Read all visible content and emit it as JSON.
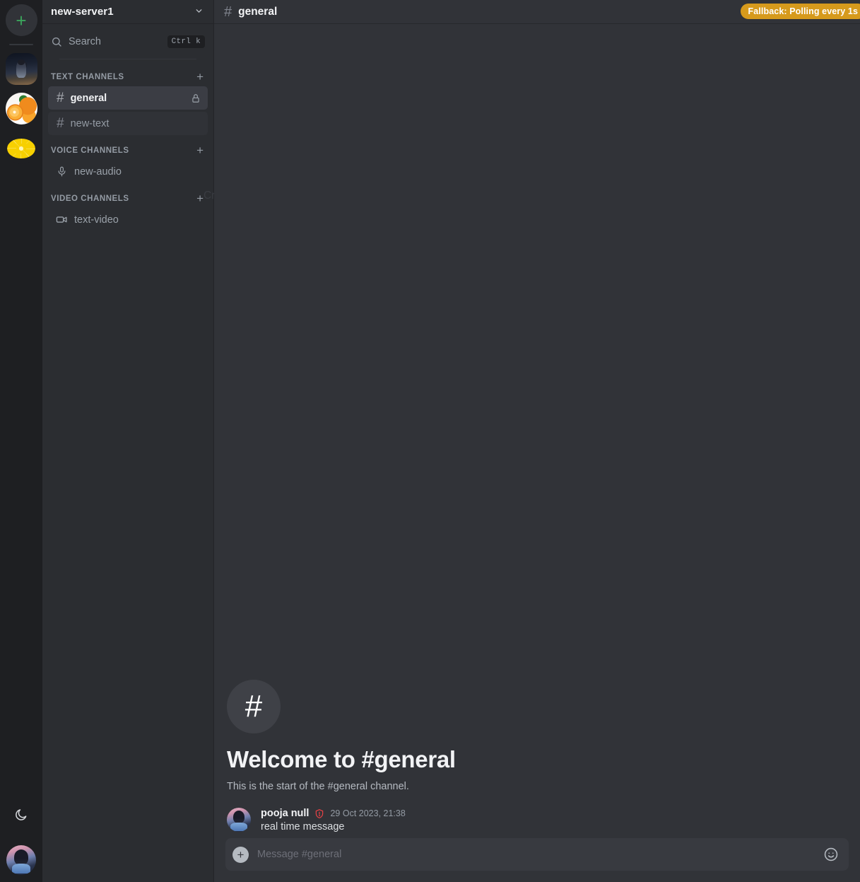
{
  "server_rail": {
    "add_server": {
      "name": "add-server-button",
      "glyph": "+",
      "accent": "#3ba55c"
    },
    "servers": [
      {
        "name": "server-icon-anime",
        "style": "sq",
        "art": "av-anime1",
        "label": ""
      },
      {
        "name": "server-icon-oranges",
        "style": "rd",
        "art": "av-orange",
        "label": ""
      },
      {
        "name": "server-icon-lemon",
        "style": "rd",
        "art": "av-lemon",
        "label": ""
      }
    ],
    "theme_toggle": {
      "icon": "moon-icon"
    },
    "user_avatar": {
      "icon": "user-avatar"
    }
  },
  "sidebar": {
    "server_name": "new-server1",
    "chevron": "⌄",
    "search": {
      "placeholder": "Search",
      "shortcut": "Ctrl k"
    },
    "ghost_tooltip": "Create Channel",
    "categories": [
      {
        "label": "TEXT CHANNELS",
        "add_label": "+",
        "channels": [
          {
            "name": "general",
            "kind": "text",
            "active": true,
            "locked": true
          },
          {
            "name": "new-text",
            "kind": "text",
            "active": false,
            "locked": false
          }
        ]
      },
      {
        "label": "VOICE CHANNELS",
        "add_label": "+",
        "channels": [
          {
            "name": "new-audio",
            "kind": "voice",
            "active": false,
            "locked": false
          }
        ]
      },
      {
        "label": "VIDEO CHANNELS",
        "add_label": "+",
        "channels": [
          {
            "name": "text-video",
            "kind": "video",
            "active": false,
            "locked": false
          }
        ]
      }
    ]
  },
  "main": {
    "header": {
      "hash": "#",
      "channel": "general"
    },
    "status_badge": {
      "text": "Fallback: Polling every 1s",
      "color": "#d69a1c"
    },
    "welcome": {
      "hash": "#",
      "title": "Welcome to #general",
      "subtitle": "This is the start of the #general channel."
    },
    "messages": [
      {
        "author": "pooja null",
        "badge": "admin-shield",
        "badge_color": "#ed4245",
        "timestamp": "29 Oct 2023, 21:38",
        "text": "real time message"
      }
    ],
    "composer": {
      "placeholder": "Message #general",
      "attach_glyph": "+",
      "emoji": "emoji-icon"
    }
  },
  "colors": {
    "rail_bg": "#1e1f22",
    "sidebar_bg": "#2b2d31",
    "main_bg": "#313338",
    "accent_green": "#3ba55c",
    "badge_amber": "#d69a1c",
    "shield_red": "#ed4245"
  }
}
